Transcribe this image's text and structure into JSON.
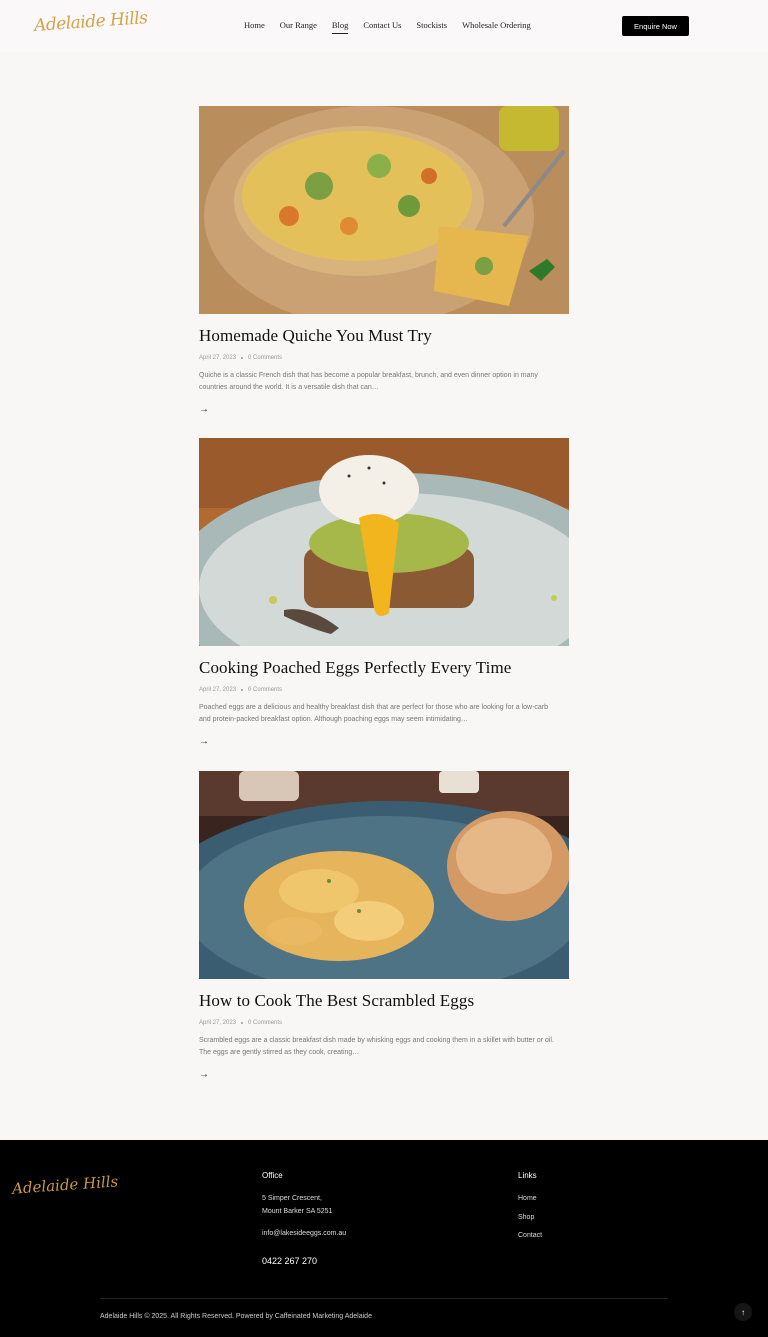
{
  "header": {
    "logo": "Adelaide Hills",
    "nav": [
      "Home",
      "Our Range",
      "Blog",
      "Contact Us",
      "Stockists",
      "Wholesale Ordering"
    ],
    "active_nav": "Blog",
    "cta": "Enquire Now"
  },
  "posts": [
    {
      "title": "Homemade Quiche You Must Try",
      "date": "April 27, 2023",
      "comments": "0 Comments",
      "excerpt": "Quiche is a classic French dish that has become a popular breakfast, brunch, and even dinner option in many countries around the world. It is a versatile dish that can…",
      "image": "quiche-photo"
    },
    {
      "title": "Cooking Poached Eggs Perfectly Every Time",
      "date": "April 27, 2023",
      "comments": "0 Comments",
      "excerpt": "Poached eggs are a delicious and healthy breakfast dish that are perfect for those who are looking for a low-carb and protein-packed breakfast option. Although poaching eggs may seem intimidating…",
      "image": "poached-egg-photo"
    },
    {
      "title": "How to Cook The Best Scrambled Eggs",
      "date": "April 27, 2023",
      "comments": "0 Comments",
      "excerpt": "Scrambled eggs are a classic breakfast dish made by whisking eggs and cooking them in a skillet with butter or oil. The eggs are gently stirred as they cook, creating…",
      "image": "scrambled-eggs-photo"
    }
  ],
  "footer": {
    "logo": "Adelaide Hills",
    "office_heading": "Office",
    "address_line1": "5 Simper Crescent,",
    "address_line2": "Mount Barker SA 5251",
    "email": "info@lakesideeggs.com.au",
    "phone": "0422 267 270",
    "links_heading": "Links",
    "links": [
      "Home",
      "Shop",
      "Contact"
    ],
    "copyright": "Adelaide Hills © 2025. All Rights Reserved. Powered by Caffeinated Marketing Adelaide",
    "back_to_top_icon": "arrow-up-icon"
  }
}
